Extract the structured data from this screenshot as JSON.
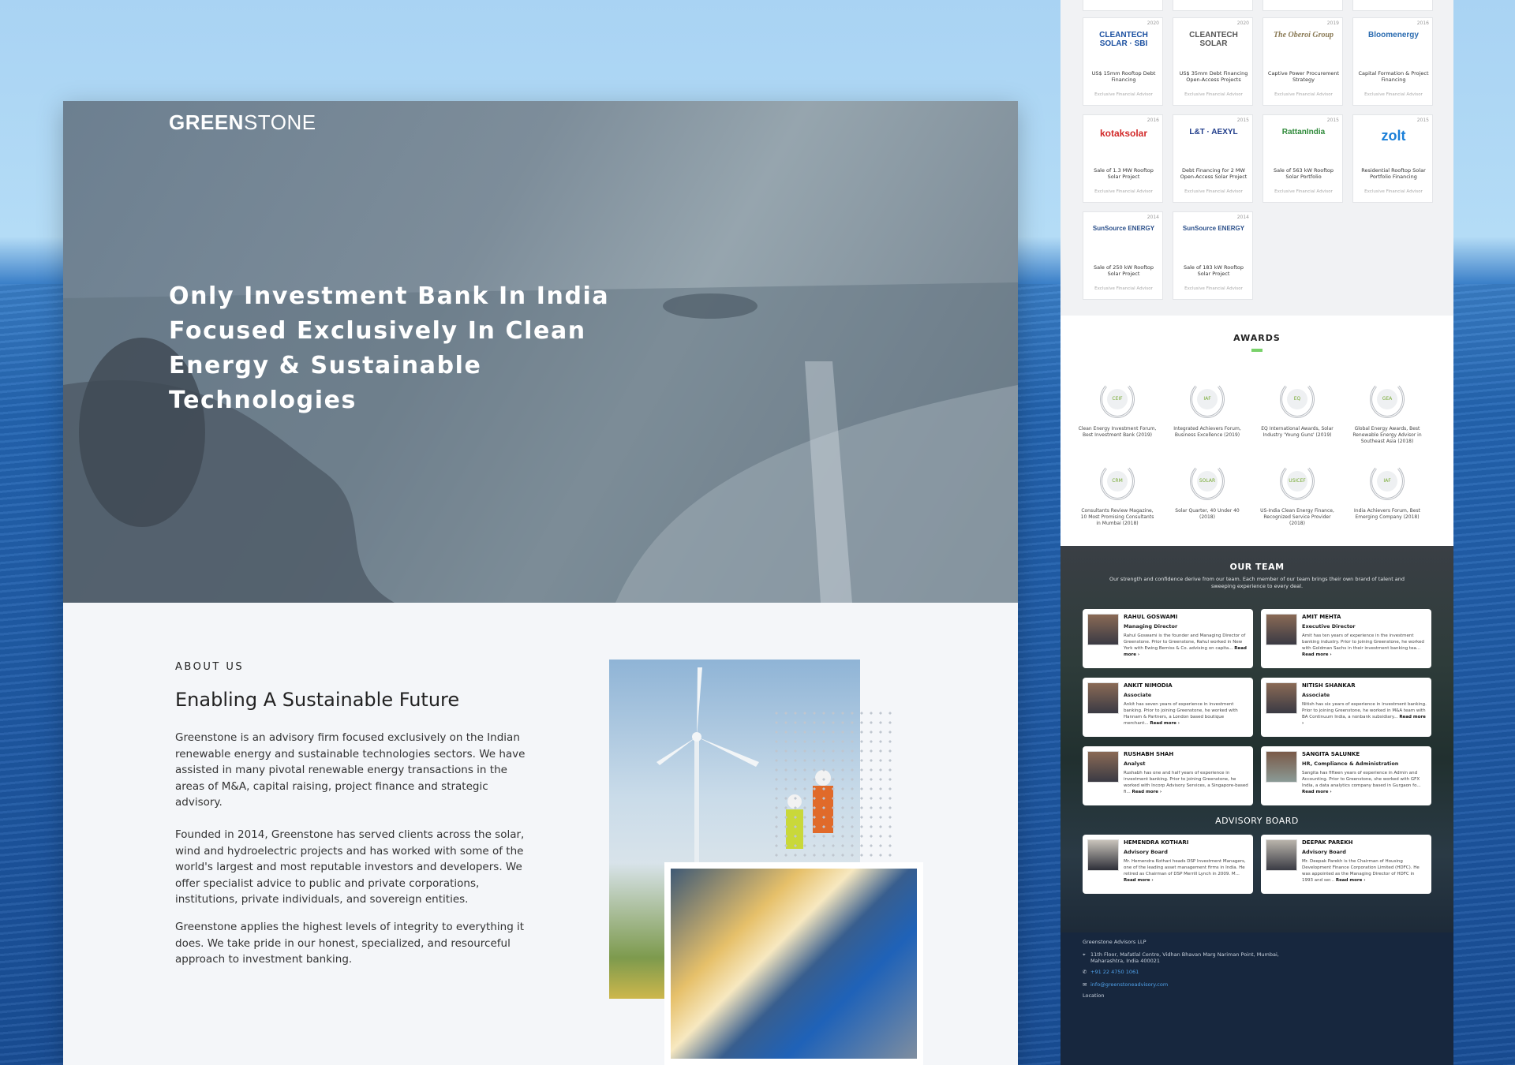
{
  "left_page": {
    "logo_bold": "GREEN",
    "logo_rest": "STONE",
    "hero_heading": "Only Investment Bank In India Focused Exclusively In Clean Energy & Sustainable Technologies",
    "about_kicker": "ABOUT US",
    "about_heading": "Enabling A Sustainable Future",
    "about_p1": "Greenstone is an advisory firm focused exclusively on the Indian renewable energy and sustainable technologies sectors. We have assisted in many pivotal renewable energy transactions in the areas of M&A, capital raising, project finance and strategic advisory.",
    "about_p2": "Founded in 2014, Greenstone has served clients across the solar, wind and hydroelectric projects and has worked with some of the world's largest and most reputable investors and developers. We offer specialist advice to public and private corporations, institutions, private individuals, and sovereign entities.",
    "about_p3": "Greenstone applies the highest levels of integrity to everything it does. We take pride in our honest, specialized, and resourceful approach to investment banking."
  },
  "deals": [
    {
      "year": "2020",
      "logo": "CLEANTECH SOLAR · SBI",
      "text": "US$ 15mm Rooftop Debt Financing",
      "advisor": "Exclusive Financial Advisor",
      "color": "#1a4fa0"
    },
    {
      "year": "2020",
      "logo": "CLEANTECH SOLAR",
      "text": "US$ 35mm Debt Financing Open-Access Projects",
      "advisor": "Exclusive Financial Advisor",
      "color": "#555555"
    },
    {
      "year": "2019",
      "logo": "The Oberoi Group",
      "text": "Captive Power Procurement Strategy",
      "advisor": "Exclusive Financial Advisor",
      "color": "#8a7a55"
    },
    {
      "year": "2016",
      "logo": "Bloomenergy",
      "text": "Capital Formation & Project Financing",
      "advisor": "Exclusive Financial Advisor",
      "color": "#2a6bb0"
    },
    {
      "year": "2016",
      "logo": "kotaksolar",
      "text": "Sale of 1.3 MW Rooftop Solar Project",
      "advisor": "Exclusive Financial Advisor",
      "color": "#d22a2a"
    },
    {
      "year": "2015",
      "logo": "L&T · AEXYL",
      "text": "Debt Financing for 2 MW Open-Access Solar Project",
      "advisor": "Exclusive Financial Advisor",
      "color": "#1f3c8a"
    },
    {
      "year": "2015",
      "logo": "RattanIndia",
      "text": "Sale of 563 kW Rooftop Solar Portfolio",
      "advisor": "Exclusive Financial Advisor",
      "color": "#2f8a3a"
    },
    {
      "year": "2015",
      "logo": "zolt",
      "text": "Residential Rooftop Solar Portfolio Financing",
      "advisor": "Exclusive Financial Advisor",
      "color": "#1a7fd8"
    },
    {
      "year": "2014",
      "logo": "SunSource ENERGY",
      "text": "Sale of 250 kW Rooftop Solar Project",
      "advisor": "Exclusive Financial Advisor",
      "color": "#2a4f8a"
    },
    {
      "year": "2014",
      "logo": "SunSource ENERGY",
      "text": "Sale of 183 kW Rooftop Solar Project",
      "advisor": "Exclusive Financial Advisor",
      "color": "#2a4f8a"
    }
  ],
  "awards_title": "AWARDS",
  "awards": [
    {
      "badge": "CEIF",
      "text": "Clean Energy Investment Forum, Best Investment Bank (2019)"
    },
    {
      "badge": "IAF",
      "text": "Integrated Achievers Forum, Business Excellence (2019)"
    },
    {
      "badge": "EQ",
      "text": "EQ International Awards, Solar Industry 'Young Guns' (2019)"
    },
    {
      "badge": "GEA",
      "text": "Global Energy Awards, Best Renewable Energy Advisor in Southeast Asia (2018)"
    },
    {
      "badge": "CRM",
      "text": "Consultants Review Magazine, 10 Most Promising Consultants in Mumbai (2018)"
    },
    {
      "badge": "SOLAR",
      "text": "Solar Quarter, 40 Under 40 (2018)"
    },
    {
      "badge": "USICEF",
      "text": "US-India Clean Energy Finance, Recognized Service Provider (2018)"
    },
    {
      "badge": "IAF",
      "text": "India Achievers Forum, Best Emerging Company (2018)"
    }
  ],
  "team": {
    "title": "OUR TEAM",
    "subtitle": "Our strength and confidence derive from our team. Each member of our team brings their own brand of talent and sweeping experience to every deal.",
    "read_more": "Read more ›",
    "members": [
      {
        "name": "RAHUL GOSWAMI",
        "role": "Managing Director",
        "desc": "Rahul Goswami is the founder and Managing Director of Greenstone. Prior to Greenstone, Rahul worked in New York with Ewing Bemiss & Co. advising on capita..."
      },
      {
        "name": "AMIT MEHTA",
        "role": "Executive Director",
        "desc": "Amit has ten years of experience in the investment banking industry. Prior to joining Greenstone, he worked with Goldman Sachs in their investment banking tea..."
      },
      {
        "name": "ANKIT NIMODIA",
        "role": "Associate",
        "desc": "Ankit has seven years of experience in investment banking. Prior to joining Greenstone, he worked with Hannam & Partners, a London based boutique merchant..."
      },
      {
        "name": "NITISH SHANKAR",
        "role": "Associate",
        "desc": "Nitish has six years of experience in investment banking. Prior to joining Greenstone, he worked in M&A team with BA Continuum India, a nonbank subsidiary..."
      },
      {
        "name": "RUSHABH SHAH",
        "role": "Analyst",
        "desc": "Rushabh has one and half years of experience in investment banking. Prior to joining Greenstone, he worked with Incorp Advisory Services, a Singapore-based fi..."
      },
      {
        "name": "SANGITA SALUNKE",
        "role": "HR, Compliance & Administration",
        "desc": "Sangita has fifteen years of experience in Admin and Accounting. Prior to Greenstone, she worked with GFX India, a data analytics company based in Gurgaon fo..."
      }
    ],
    "advisory_title": "ADVISORY BOARD",
    "advisors": [
      {
        "name": "HEMENDRA KOTHARI",
        "role": "Advisory Board",
        "desc": "Mr. Hemendra Kothari heads DSP Investment Managers, one of the leading asset management firms in India. He retired as Chairman of DSP Merrill Lynch in 2009. M..."
      },
      {
        "name": "DEEPAK PAREKH",
        "role": "Advisory Board",
        "desc": "Mr. Deepak Parekh is the Chairman of Housing Development Finance Corporation Limited (HDFC). He was appointed as the Managing Director of HDFC in 1993 and ser..."
      }
    ]
  },
  "footer": {
    "company": "Greenstone Advisors LLP",
    "address": "11th Floor, Mafatlal Centre, Vidhan Bhavan Marg Nariman Point, Mumbai, Maharashtra, India 400021",
    "phone": "+91 22 4750 1061",
    "email": "info@greenstoneadvisory.com",
    "location": "Location"
  }
}
